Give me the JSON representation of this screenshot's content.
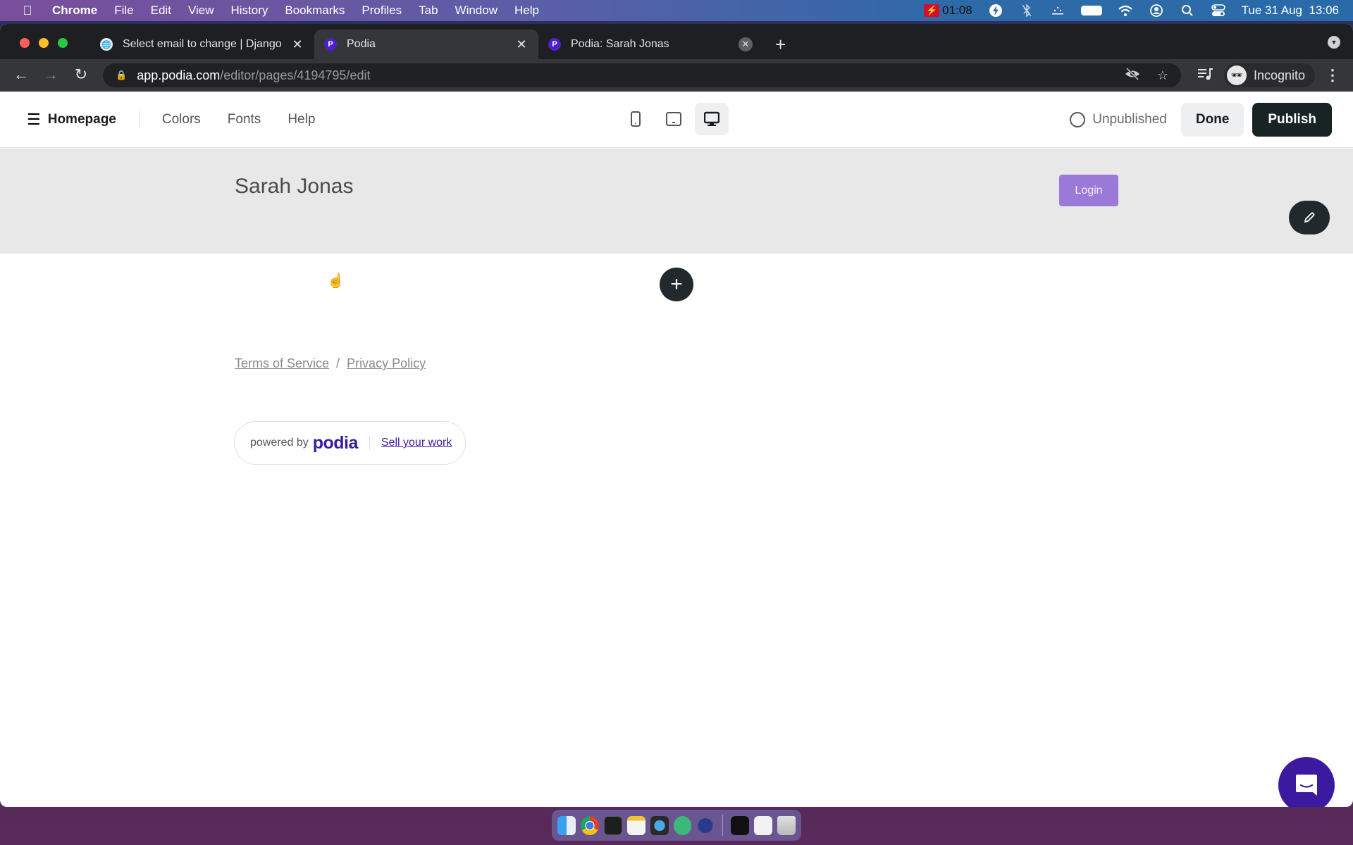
{
  "menubar": {
    "apple_icon": "apple-logo",
    "app_name": "Chrome",
    "items": [
      "File",
      "Edit",
      "View",
      "History",
      "Bookmarks",
      "Profiles",
      "Tab",
      "Window",
      "Help"
    ],
    "recording_time": "01:08",
    "datetime": "Tue 31 Aug  13:06"
  },
  "browser": {
    "tabs": [
      {
        "title": "Select email to change | Django",
        "favicon": "globe-icon",
        "active": false
      },
      {
        "title": "Podia",
        "favicon": "podia-icon",
        "active": true
      },
      {
        "title": "Podia: Sarah Jonas",
        "favicon": "podia-icon",
        "active": false
      }
    ],
    "url_host": "app.podia.com",
    "url_path": "/editor/pages/4194795/edit",
    "profile_label": "Incognito"
  },
  "editor": {
    "page_name": "Homepage",
    "nav_links": [
      "Colors",
      "Fonts",
      "Help"
    ],
    "device_modes": [
      "mobile",
      "tablet",
      "desktop"
    ],
    "active_device": "desktop",
    "status": "Unpublished",
    "done_label": "Done",
    "publish_label": "Publish"
  },
  "site": {
    "title": "Sarah Jonas",
    "login_label": "Login",
    "legal_links": [
      "Terms of Service",
      "Privacy Policy"
    ],
    "legal_separator": "/",
    "powered_by": "powered by",
    "brand": "podia",
    "sell_link": "Sell your work"
  },
  "colors": {
    "login_button": "#9b79d9",
    "podia_brand": "#3b1c9c",
    "publish_button": "#182323",
    "chat_fab": "#3b1aa0"
  }
}
